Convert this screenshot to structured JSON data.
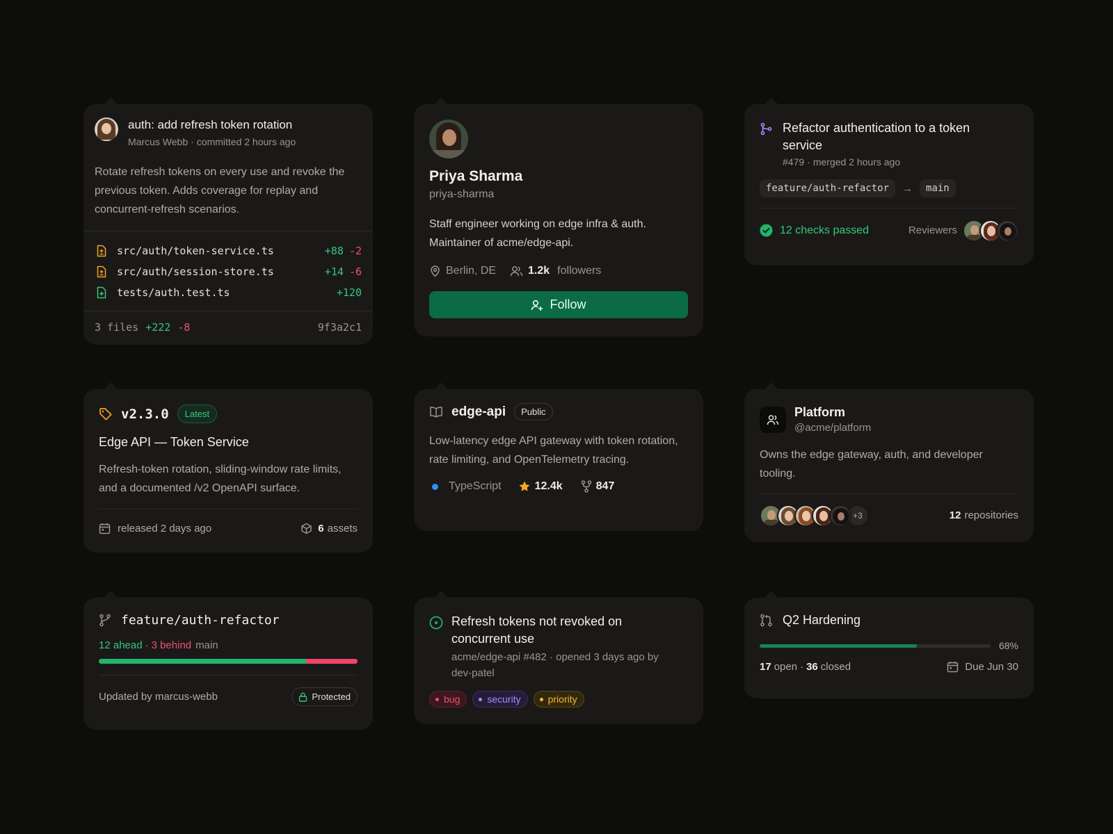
{
  "colors": {
    "background": "#0d0d0c",
    "card": "#1a1918",
    "accent_green": "#0b6b45",
    "addition": "#34c77b",
    "deletion": "#f0506e",
    "typescript": "#3178c6",
    "star": "#f5a623",
    "pr_icon": "#a78bfa",
    "tag_icon": "#f5a623"
  },
  "commit": {
    "title": "auth: add refresh token rotation",
    "author": "Marcus Webb",
    "sep": "·",
    "time": "committed 2 hours ago",
    "description": "Rotate refresh tokens on every use and revoke the previous token. Adds coverage for replay and concurrent-refresh scenarios.",
    "files": [
      {
        "icon": "file-modified-icon",
        "name": "src/auth/token-service.ts",
        "add": "+88",
        "del": "-2"
      },
      {
        "icon": "file-modified-icon",
        "name": "src/auth/session-store.ts",
        "add": "+14",
        "del": "-6"
      },
      {
        "icon": "file-added-icon",
        "name": "tests/auth.test.ts",
        "add": "+120",
        "del": ""
      }
    ],
    "summary_files": "3 files",
    "summary_add": "+222",
    "summary_del": "-8",
    "hash": "9f3a2c1"
  },
  "profile": {
    "name": "Priya Sharma",
    "handle": "priya-sharma",
    "bio": "Staff engineer working on edge infra & auth. Maintainer of acme/edge-api.",
    "location": "Berlin, DE",
    "followers_count": "1.2k",
    "followers_label": "followers",
    "follow_label": "Follow"
  },
  "pull_request": {
    "title": "Refactor authentication to a token service",
    "number": "#479",
    "status": "merged 2 hours ago",
    "sep": "·",
    "head_branch": "feature/auth-refactor",
    "arrow": "→",
    "base_branch": "main",
    "checks": "12 checks passed",
    "reviewers_label": "Reviewers"
  },
  "release": {
    "version": "v2.3.0",
    "badge": "Latest",
    "title": "Edge API — Token Service",
    "description": "Refresh-token rotation, sliding-window rate limits, and a documented /v2 OpenAPI surface.",
    "released": "released 2 days ago",
    "assets_count": "6",
    "assets_label": "assets"
  },
  "repo": {
    "name": "edge-api",
    "visibility": "Public",
    "description": "Low-latency edge API gateway with token rotation, rate limiting, and OpenTelemetry tracing.",
    "language": "TypeScript",
    "stars": "12.4k",
    "forks": "847"
  },
  "team": {
    "name": "Platform",
    "handle": "@acme/platform",
    "description": "Owns the edge gateway, auth, and developer tooling.",
    "extra_members": "+3",
    "repos_count": "12",
    "repos_label": "repositories"
  },
  "branch": {
    "name": "feature/auth-refactor",
    "ahead": "12 ahead",
    "sep": "·",
    "behind": "3 behind",
    "base": "main",
    "ahead_fraction": 0.8,
    "updated": "Updated by marcus-webb",
    "protected": "Protected"
  },
  "issue": {
    "title": "Refresh tokens not revoked on concurrent use",
    "meta": "acme/edge-api #482 · opened 3 days ago by dev-patel",
    "labels": [
      {
        "name": "bug",
        "color": "#f0506e",
        "bg": "#3a1820",
        "border": "#5a2230"
      },
      {
        "name": "security",
        "color": "#a78bfa",
        "bg": "#241d3a",
        "border": "#3a2f5c"
      },
      {
        "name": "priority",
        "color": "#f5b82e",
        "bg": "#33280f",
        "border": "#5a4714"
      }
    ]
  },
  "milestone": {
    "name": "Q2 Hardening",
    "percent": "68%",
    "progress": 0.68,
    "open_count": "17",
    "open_label": "open",
    "sep": "·",
    "closed_count": "36",
    "closed_label": "closed",
    "due": "Due Jun 30"
  }
}
